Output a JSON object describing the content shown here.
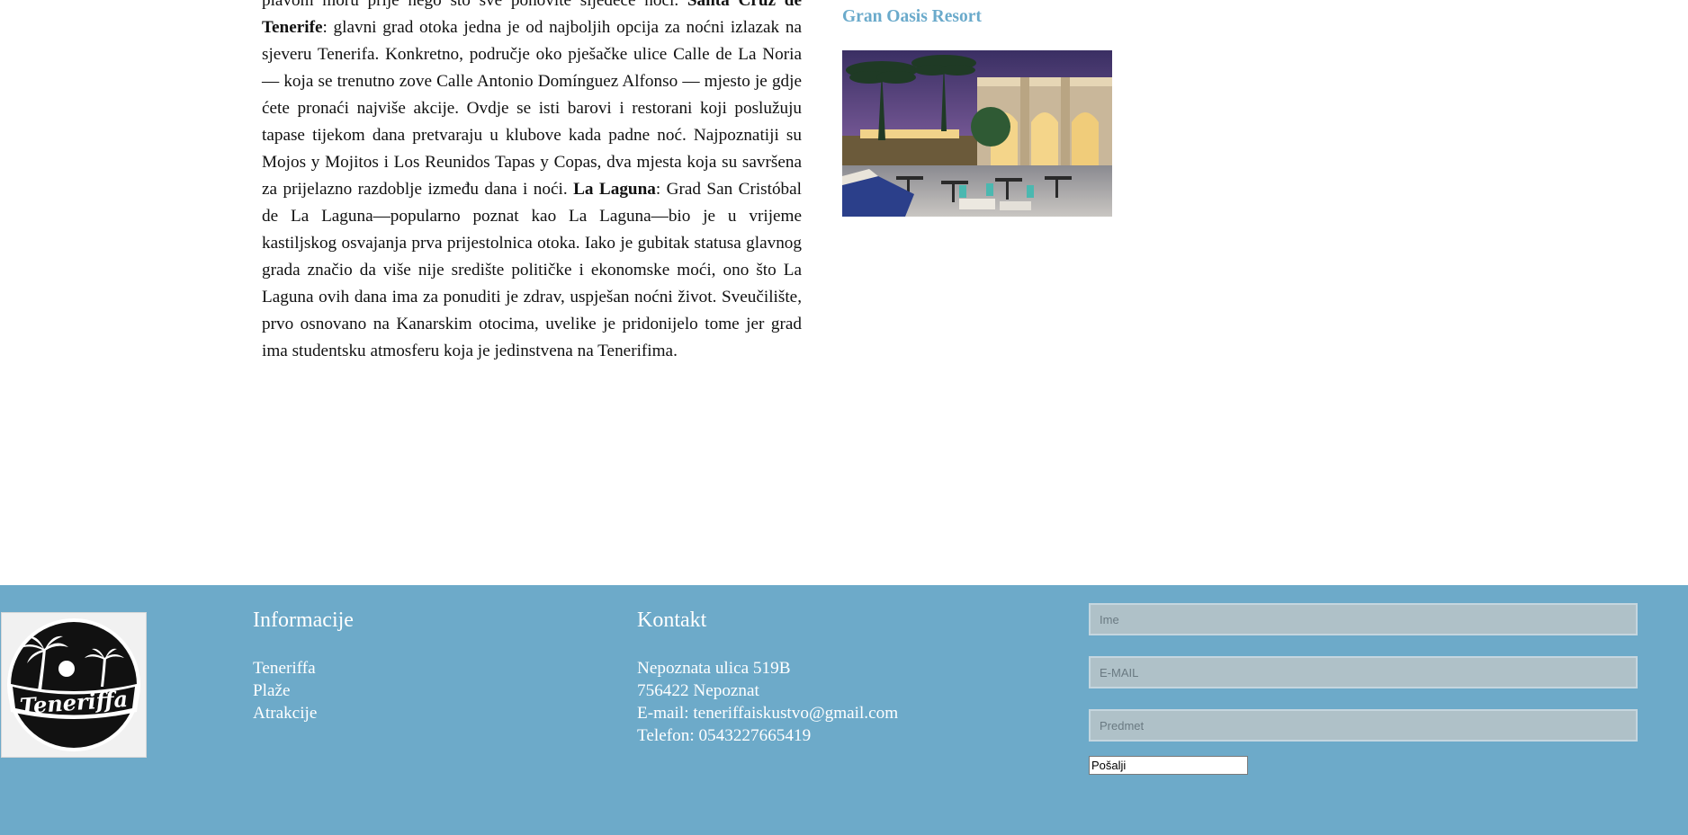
{
  "article": {
    "line0": "plavom moru prije nego što sve ponovite sljedeće noći.",
    "santa_cruz_bold": "Santa Cruz de Tenerife",
    "santa_cruz_text": ": glavni grad otoka jedna je od najboljih opcija za noćni izlazak na sjeveru Tenerifa. Konkretno, područje oko pješačke ulice Calle de La Noria — koja se trenutno zove Calle Antonio Domínguez Alfonso — mjesto je gdje ćete pronaći najviše akcije. Ovdje se isti barovi i restorani koji poslužuju tapase tijekom dana pretvaraju u klubove kada padne noć. Najpoznatiji su Mojos y Mojitos i Los Reunidos Tapas y Copas, dva mjesta koja su savršena za prijelazno razdoblje između dana i noći.",
    "la_laguna_bold": "La Laguna",
    "la_laguna_text": ": Grad San Cristóbal de La Laguna—popularno poznat kao La Laguna—bio je u vrijeme kastiljskog osvajanja prva prijestolnica otoka. Iako je gubitak statusa glavnog grada značio da više nije središte političke i ekonomske moći, ono što La Laguna ovih dana ima za ponuditi je zdrav, uspješan noćni život. Sveučilište, prvo osnovano na Kanarskim otocima, uvelike je pridonijelo tome jer grad ima studentsku atmosferu koja je jedinstvena na Tenerifima."
  },
  "sidebar": {
    "resort_title": "Gran Oasis Resort"
  },
  "footer": {
    "logo_text": "Teneriffa",
    "info": {
      "heading": "Informacije",
      "links": [
        "Teneriffa",
        "Plaže",
        "Atrakcije"
      ]
    },
    "contact": {
      "heading": "Kontakt",
      "lines": [
        "Nepoznata ulica 519B",
        "756422 Nepoznat",
        "E-mail: teneriffaiskustvo@gmail.com",
        "Telefon: 0543227665419"
      ]
    },
    "form": {
      "name_placeholder": "Ime",
      "email_placeholder": "E-MAIL",
      "subject_placeholder": "Predmet",
      "submit_label": "Pošalji"
    }
  },
  "colors": {
    "footer_bg": "#6daac9",
    "accent": "#6aaacb",
    "input_bg": "#afc1c8"
  }
}
